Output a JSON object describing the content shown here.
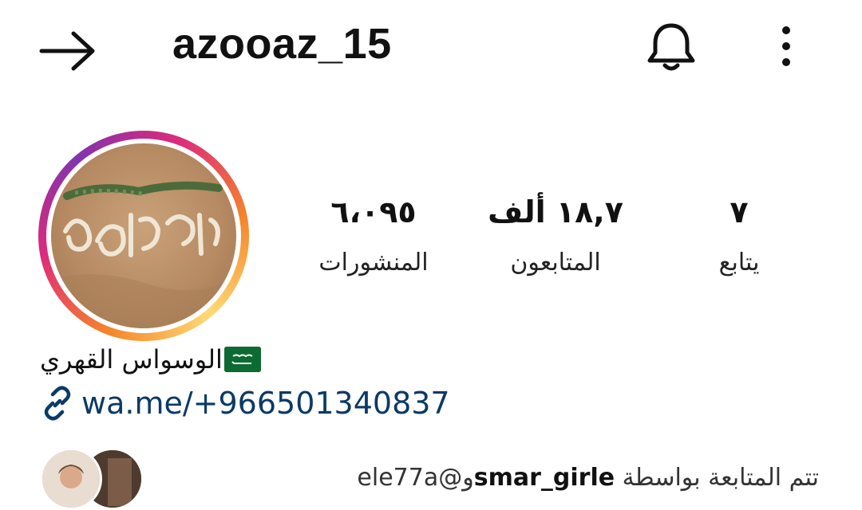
{
  "header": {
    "back_icon": "arrow-right-icon",
    "username": "azooaz_15",
    "bell_icon": "bell-icon",
    "more_icon": "vertical-dots-icon"
  },
  "stats": {
    "posts_count": "٦،٠٩٥",
    "posts_label": "المنشورات",
    "followers_count": "١٨,٧ ألف",
    "followers_label": "المتابعون",
    "following_count": "٧",
    "following_label": "يتابع"
  },
  "bio": {
    "name": "الوسواس القهري",
    "flag_icon": "saudi-flag-icon",
    "link_icon": "link-icon",
    "link": "wa.me/+966501340837"
  },
  "followed_by": {
    "prefix": "تتم المتابعة بواسطة",
    "user1": "smar_girle",
    "joiner": "و",
    "user2": "@ele77a"
  },
  "colors": {
    "link": "#0b3a66",
    "story_ring_start": "#f58529",
    "story_ring_mid": "#dd2a7b",
    "story_ring_end": "#8134af"
  }
}
